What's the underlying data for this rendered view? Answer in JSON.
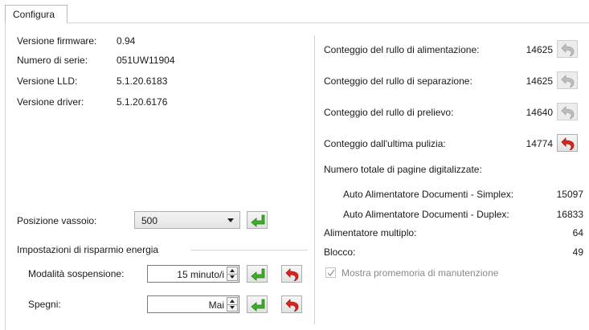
{
  "tabs": [
    {
      "label": "Configura"
    }
  ],
  "device_info": [
    {
      "label": "Versione firmware:",
      "value": "0.94"
    },
    {
      "label": "Numero di serie:",
      "value": "051UW11904"
    },
    {
      "label": "Versione LLD:",
      "value": "5.1.20.6183"
    },
    {
      "label": "Versione driver:",
      "value": "5.1.20.6176"
    }
  ],
  "tray": {
    "label": "Posizione vassoio:",
    "value": "500"
  },
  "power": {
    "group_label": "Impostazioni di risparmio energia",
    "sleep": {
      "label": "Modalità sospensione:",
      "value": "15 minuto/i"
    },
    "off": {
      "label": "Spegni:",
      "value": "Mai"
    }
  },
  "counters": [
    {
      "label": "Conteggio del rullo di alimentazione:",
      "value": "14625",
      "reset_enabled": false
    },
    {
      "label": "Conteggio del rullo di separazione:",
      "value": "14625",
      "reset_enabled": false
    },
    {
      "label": "Conteggio del rullo di prelievo:",
      "value": "14640",
      "reset_enabled": false
    },
    {
      "label": "Conteggio dall'ultima pulizia:",
      "value": "14774",
      "reset_enabled": true
    }
  ],
  "totals": {
    "heading": "Numero totale di pagine digitalizzate:",
    "simplex": {
      "label": "Auto Alimentatore Documenti - Simplex:",
      "value": "15097"
    },
    "duplex": {
      "label": "Auto Alimentatore Documenti - Duplex:",
      "value": "16833"
    },
    "multifeed": {
      "label": "Alimentatore multiplo:",
      "value": "64"
    },
    "jam": {
      "label": "Blocco:",
      "value": "49"
    }
  },
  "reminder": {
    "label": "Mostra promemoria di manutenzione",
    "checked": true,
    "enabled": false
  },
  "colors": {
    "apply_green": "#3fae2a",
    "reset_red": "#d9251d",
    "disabled_gray": "#bdbdbd"
  }
}
